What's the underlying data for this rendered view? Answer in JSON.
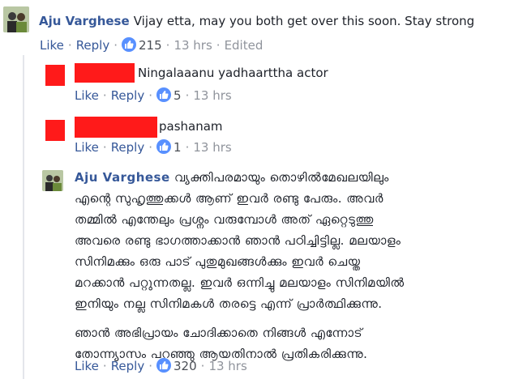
{
  "comments": [
    {
      "author": "Aju Varghese",
      "text": "Vijay etta, may you both get over this soon. Stay strong",
      "actions": {
        "like": "Like",
        "reply": "Reply",
        "likes": "215",
        "time": "13 hrs",
        "edited": "Edited"
      }
    },
    {
      "author": "",
      "text": "Ningalaaanu yadhaarttha actor",
      "actions": {
        "like": "Like",
        "reply": "Reply",
        "likes": "5",
        "time": "13 hrs"
      }
    },
    {
      "author": "",
      "text": "pashanam",
      "actions": {
        "like": "Like",
        "reply": "Reply",
        "likes": "1",
        "time": "13 hrs"
      }
    },
    {
      "author": "Aju Varghese",
      "lines": [
        "വ്യക്തിപരമായും തൊഴിൽമേഖലയിലും",
        "എന്റെ സുഹൃത്തുക്കൾ ആണ് ഇവർ രണ്ടു പേരും. അവർ",
        "തമ്മിൽ എന്തേലും പ്രശ്നം വരുമ്പോൾ അത് ഏറ്റെടുത്തു",
        "അവരെ രണ്ടു ഭാഗത്താക്കാൻ ഞാൻ പഠിച്ചിട്ടില്ല. മലയാളം",
        "സിനിമക്കും ഒരു പാട് പുതുമുഖങ്ങൾക്കും ഇവർ ചെയ്ത",
        "മറക്കാൻ പറ്റുന്നതല്ല. ഇവർ ഒന്നിച്ചു മലയാളം സിനിമയിൽ",
        "ഇനിയും നല്ല സിനിമകൾ തരട്ടെ എന്ന് പ്രാർത്ഥിക്കുന്നു.",
        "ഞാൻ അഭിപ്രായം ചോദിക്കാതെ നിങ്ങൾ എന്നോട്",
        "തോന്ന്യാസം പറഞ്ഞു ആയതിനാൽ പ്രതികരിക്കുന്നു."
      ],
      "actions": {
        "like": "Like",
        "reply": "Reply",
        "likes": "320",
        "time": "13 hrs"
      }
    }
  ],
  "colors": {
    "link": "#365899",
    "meta": "#90949c",
    "like_badge": "#5890ff",
    "redaction": "#ff1a1a"
  }
}
